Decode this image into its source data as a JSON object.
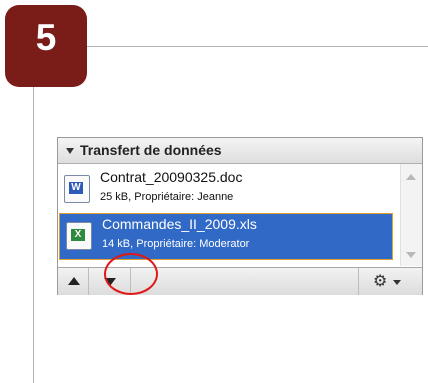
{
  "step": {
    "number": "5",
    "badge_color": "#7a1c18"
  },
  "panel": {
    "title": "Transfert de données",
    "files": [
      {
        "name": "Contrat_20090325.doc",
        "meta": "25 kB, Propriétaire: Jeanne",
        "icon": "word-doc-icon",
        "icon_glyph": "W",
        "selected": false
      },
      {
        "name": "Commandes_II_2009.xls",
        "meta": "14 kB, Propriétaire: Moderator",
        "icon": "excel-xls-icon",
        "icon_glyph": "X",
        "selected": true
      }
    ],
    "selection_color": "#3169c6",
    "toolbar": {
      "move_up_icon": "arrow-up-icon",
      "move_down_icon": "arrow-down-icon",
      "settings_icon": "gear-icon",
      "settings_glyph": "⚙"
    }
  },
  "annotation": {
    "highlight_color": "#e01818"
  }
}
